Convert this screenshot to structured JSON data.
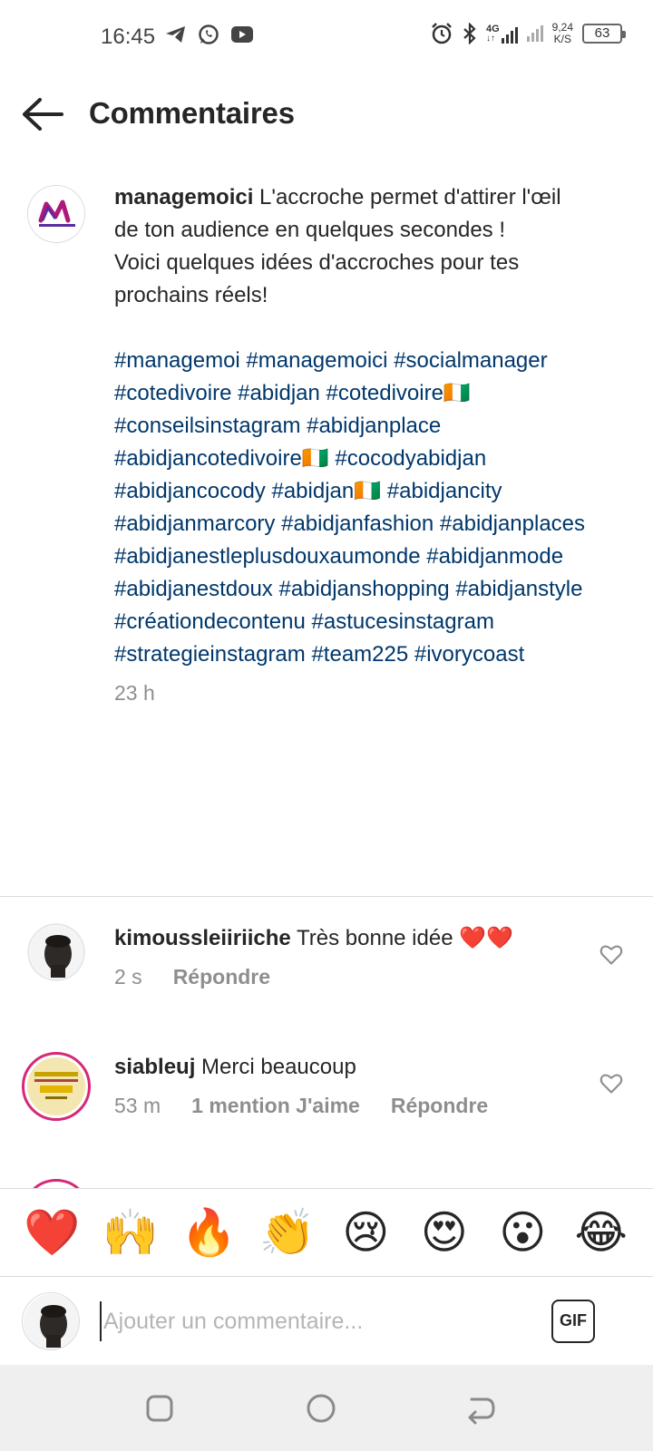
{
  "status_bar": {
    "time": "16:45",
    "network": "4G",
    "speed_value": "9,24",
    "speed_unit": "K/S",
    "battery": "63",
    "left_icons": [
      "telegram-icon",
      "whatsapp-icon",
      "youtube-icon"
    ],
    "right_icons": [
      "alarm-icon",
      "bluetooth-icon",
      "signal-icon",
      "signal-weak-icon",
      "battery-icon"
    ]
  },
  "header": {
    "title": "Commentaires"
  },
  "caption": {
    "username": "managemoici",
    "text_line1": " L'accroche permet d'attirer l'œil de ton audience en quelques secondes !",
    "text_line2": "Voici quelques idées d'accroches pour tes prochains réels!",
    "hashtags": [
      "#managemoi",
      "#managemoici",
      "#socialmanager",
      "#cotedivoire",
      "#abidjan",
      "#cotedivoire🇨🇮",
      "#conseilsinstagram",
      "#abidjanplace",
      "#abidjancotedivoire🇨🇮",
      "#cocodyabidjan",
      "#abidjancocody",
      "#abidjan🇨🇮",
      "#abidjancity",
      "#abidjanmarcory",
      "#abidjanfashion",
      "#abidjanplaces",
      "#abidjanestleplusdouxaumonde",
      "#abidjanmode",
      "#abidjanestdoux",
      "#abidjanshopping",
      "#abidjanstyle",
      "#créationdecontenu",
      "#astucesinstagram",
      "#strategieinstagram",
      "#team225",
      "#ivorycoast"
    ],
    "time": "23 h"
  },
  "comments": [
    {
      "username": "kimoussleiiriiche",
      "text": " Très bonne idée ❤️❤️",
      "time": "2 s",
      "likes": "",
      "reply": "Répondre"
    },
    {
      "username": "siableuj",
      "text": " Merci beaucoup",
      "time": "53 m",
      "likes": "1 mention J'aime",
      "reply": "Répondre"
    }
  ],
  "emojis": [
    "❤️",
    "🙌",
    "🔥",
    "👏",
    "😢",
    "😍",
    "😮",
    "😂"
  ],
  "input": {
    "placeholder": "Ajouter un commentaire...",
    "gif_label": "GIF"
  },
  "colors": {
    "hashtag": "#00376b",
    "secondary_text": "#8e8e8e",
    "primary_text": "#262626"
  }
}
